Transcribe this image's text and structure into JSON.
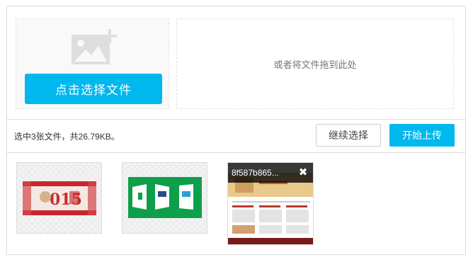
{
  "drop": {
    "icon": "image-add-icon",
    "pick_label": "点击选择文件",
    "drag_hint": "或者将文件拖到此处"
  },
  "status": {
    "info": "选中3张文件，共26.79KB。",
    "continue_label": "继续选择",
    "start_label": "开始上传"
  },
  "files": [
    {
      "name": "",
      "preview": "red festive banner"
    },
    {
      "name": "",
      "preview": "green tiles banner"
    },
    {
      "name": "8f587b865...",
      "preview": "webpage screenshot"
    }
  ],
  "colors": {
    "accent": "#00b7ee",
    "tile_green": "#0e9f4a"
  }
}
